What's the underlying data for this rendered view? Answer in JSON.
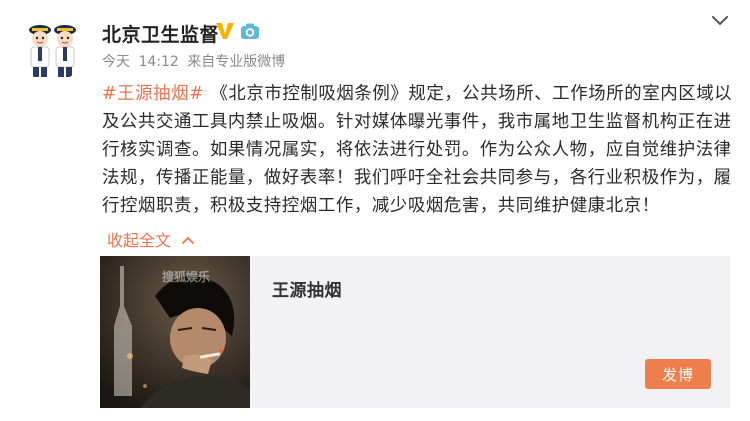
{
  "user": {
    "name": "北京卫生监督",
    "verified_badge": "V"
  },
  "post_meta": {
    "date": "今天",
    "time": "14:12",
    "from_label": "来自",
    "source": "专业版微博"
  },
  "post": {
    "hashtag": "#王源抽烟#",
    "text": " 《北京市控制吸烟条例》规定，公共场所、工作场所的室内区域以及公共交通工具内禁止吸烟。针对媒体曝光事件，我市属地卫生监督机构正在进行核实调查。如果情况属实，将依法进行处罚。作为公众人物，应自觉维护法律法规，传播正能量，做好表率！我们呼吁全社会共同参与，各行业积极作为，履行控烟职责，积极支持控烟工作，减少吸烟危害，共同维护健康北京！",
    "collapse_label": "收起全文"
  },
  "card": {
    "title": "王源抽烟",
    "watermark": "搜狐娱乐",
    "post_button": "发博"
  },
  "icons": {
    "verified": "verified-v-icon",
    "camera": "camera-icon",
    "collapse": "chevron-up-icon",
    "menu": "chevron-down-icon"
  },
  "colors": {
    "accent": "#eb7350",
    "verified": "#f4b400",
    "button": "#ee7f4c",
    "card_bg": "#f2f2f5"
  }
}
